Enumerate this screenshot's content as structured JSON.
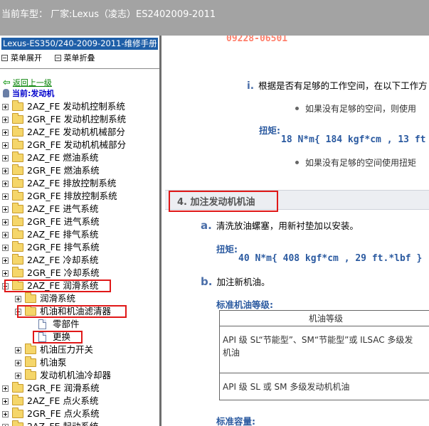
{
  "window": {
    "title": "当前车型： 厂家:Lexus（凌志）ES2402009-2011"
  },
  "sidebar": {
    "manual_title": "Lexus-ES350/240-2009-2011-维修手册",
    "toolbar": {
      "expand_label": "菜单展开",
      "collapse_label": "菜单折叠"
    },
    "back_link": "返回上一级",
    "current": "当前:发动机",
    "items": [
      {
        "label": "2AZ_FE 发动机控制系统",
        "type": "folder",
        "level": 0,
        "expander": "plus"
      },
      {
        "label": "2GR_FE 发动机控制系统",
        "type": "folder",
        "level": 0,
        "expander": "plus"
      },
      {
        "label": "2AZ_FE 发动机机械部分",
        "type": "folder",
        "level": 0,
        "expander": "plus"
      },
      {
        "label": "2GR_FE 发动机机械部分",
        "type": "folder",
        "level": 0,
        "expander": "plus"
      },
      {
        "label": "2AZ_FE 燃油系统",
        "type": "folder",
        "level": 0,
        "expander": "plus"
      },
      {
        "label": "2GR_FE 燃油系统",
        "type": "folder",
        "level": 0,
        "expander": "plus"
      },
      {
        "label": "2AZ_FE 排放控制系统",
        "type": "folder",
        "level": 0,
        "expander": "plus"
      },
      {
        "label": "2GR_FE 排放控制系统",
        "type": "folder",
        "level": 0,
        "expander": "plus"
      },
      {
        "label": "2AZ_FE 进气系统",
        "type": "folder",
        "level": 0,
        "expander": "plus"
      },
      {
        "label": "2GR_FE 进气系统",
        "type": "folder",
        "level": 0,
        "expander": "plus"
      },
      {
        "label": "2AZ_FE 排气系统",
        "type": "folder",
        "level": 0,
        "expander": "plus"
      },
      {
        "label": "2GR_FE 排气系统",
        "type": "folder",
        "level": 0,
        "expander": "plus"
      },
      {
        "label": "2AZ_FE 冷却系统",
        "type": "folder",
        "level": 0,
        "expander": "plus"
      },
      {
        "label": "2GR_FE 冷却系统",
        "type": "folder",
        "level": 0,
        "expander": "plus"
      },
      {
        "label": "2AZ_FE 润滑系统",
        "type": "folder",
        "level": 0,
        "expander": "minus",
        "highlighted": true
      },
      {
        "label": "润滑系统",
        "type": "folder",
        "level": 1,
        "expander": "plus"
      },
      {
        "label": "机油和机油滤清器",
        "type": "folder",
        "level": 1,
        "expander": "minus",
        "highlighted": true
      },
      {
        "label": "零部件",
        "type": "doc",
        "level": 2
      },
      {
        "label": "更换",
        "type": "doc",
        "level": 2,
        "highlighted": true
      },
      {
        "label": "机油压力开关",
        "type": "folder",
        "level": 1,
        "expander": "plus"
      },
      {
        "label": "机油泵",
        "type": "folder",
        "level": 1,
        "expander": "plus"
      },
      {
        "label": "发动机机油冷却器",
        "type": "folder",
        "level": 1,
        "expander": "plus"
      },
      {
        "label": "2GR_FE 润滑系统",
        "type": "folder",
        "level": 0,
        "expander": "plus"
      },
      {
        "label": "2AZ_FE 点火系统",
        "type": "folder",
        "level": 0,
        "expander": "plus"
      },
      {
        "label": "2GR_FE 点火系统",
        "type": "folder",
        "level": 0,
        "expander": "plus"
      },
      {
        "label": "2AZ_FE 起动系统",
        "type": "folder",
        "level": 0,
        "expander": "plus"
      }
    ]
  },
  "content": {
    "part_number": "09228-06501",
    "step_i": {
      "numeral": "i.",
      "text": "根据是否有足够的工作空间，在以下工作方"
    },
    "bullet_1": "如果没有足够的空间，则使用",
    "torque_1": {
      "label": "扭矩:",
      "value": "18 N*m{ 184 kgf*cm , 13 ft"
    },
    "bullet_2": "如果没有足够的空间使用扭矩",
    "section_title": "4. 加注发动机机油",
    "step_a": {
      "letter": "a.",
      "text": "清洗放油螺塞，用新衬垫加以安装。"
    },
    "torque_2": {
      "label": "扭矩:",
      "value": "40 N*m{ 408 kgf*cm , 29 ft.*lbf }"
    },
    "step_b": {
      "letter": "b.",
      "text": "加注新机油。"
    },
    "oil_grade_heading": "标准机油等级:",
    "oil_table": {
      "header": "机油等级",
      "row1_line1": "API 级 SL“节能型”、SM“节能型”或 ILSAC 多级发",
      "row1_line2": "机油",
      "row2": "API 级 SL 或 SM 多级发动机机油"
    },
    "capacity_heading": "标准容量:"
  },
  "colors": {
    "titlebar": "#a3a3a3",
    "manual_header": "#1f5fa8",
    "highlight_border": "#e01818",
    "accent_blue": "#2b5aa0",
    "part_number": "#ff7f6b"
  }
}
